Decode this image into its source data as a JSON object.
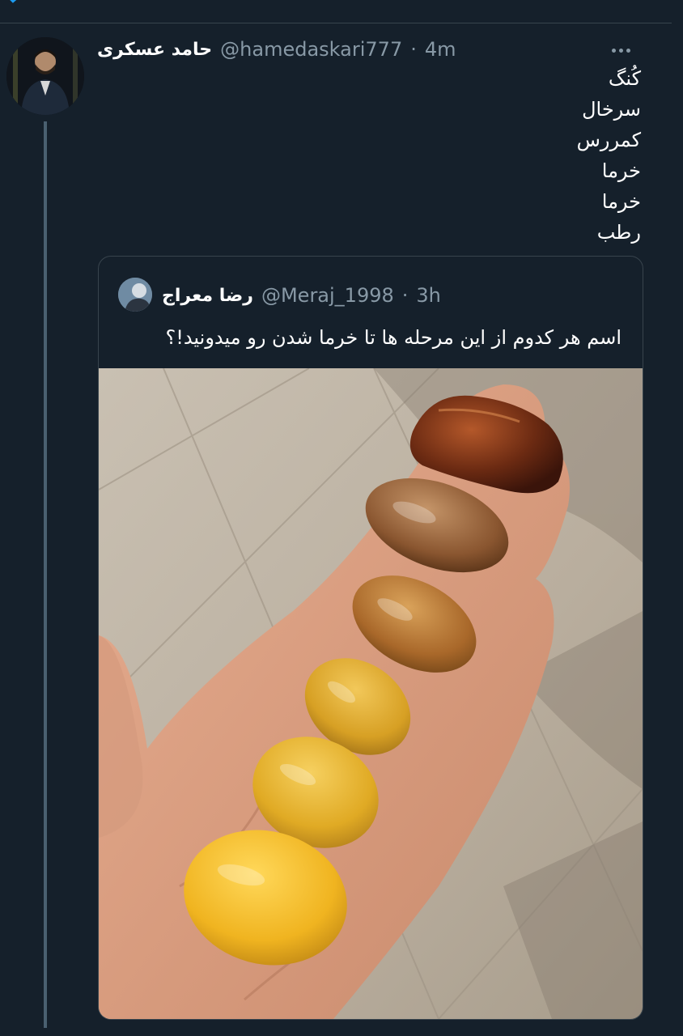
{
  "tweet": {
    "author_name": "حامد عسکری",
    "author_handle": "@hamedaskari777",
    "time": "4m",
    "lines": [
      "کُنگ",
      "سرخال",
      "کمررس",
      "خرما",
      "خرما",
      "رطب"
    ]
  },
  "quoted_tweet": {
    "author_name": "رضا معراج",
    "author_handle": "@Meraj_1998",
    "time": "3h",
    "text": "اسم هر کدوم از این مرحله ها تا خرما شدن رو میدونید!؟"
  },
  "colors": {
    "background": "#15202b",
    "border": "#38444d",
    "muted_text": "#8899a6",
    "accent": "#1d9bf0"
  },
  "icons": {
    "more": "more-horizontal-icon",
    "check": "check-icon"
  }
}
